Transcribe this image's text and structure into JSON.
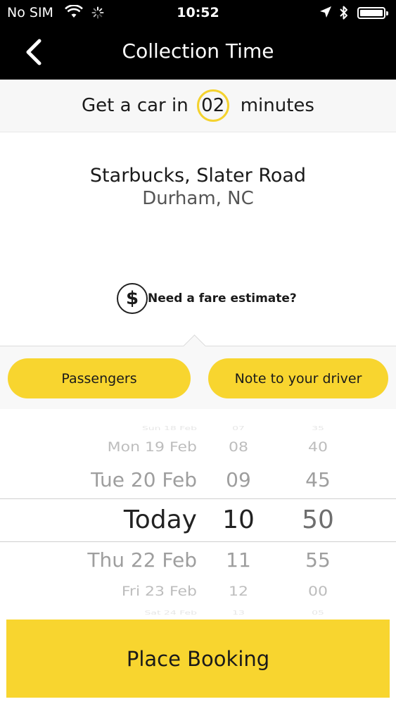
{
  "status": {
    "carrier": "No SIM",
    "time": "10:52"
  },
  "nav": {
    "title": "Collection Time",
    "back_icon": "chevron-left-icon"
  },
  "eta": {
    "prefix": "Get a car in",
    "minutes": "02",
    "suffix": "minutes"
  },
  "location": {
    "name": "Starbucks, Slater Road",
    "city": "Durham, NC"
  },
  "fare": {
    "icon": "$",
    "label": "Need a fare estimate?"
  },
  "options": {
    "passengers": "Passengers",
    "note": "Note to your driver"
  },
  "picker": {
    "days": [
      "Sun 18 Feb",
      "Mon 19 Feb",
      "Tue 20 Feb",
      "Today",
      "Thu 22 Feb",
      "Fri 23 Feb",
      "Sat 24 Feb"
    ],
    "hours": [
      "07",
      "08",
      "09",
      "10",
      "11",
      "12",
      "13"
    ],
    "minutes": [
      "35",
      "40",
      "45",
      "50",
      "55",
      "00",
      "05"
    ]
  },
  "actions": {
    "place_booking": "Place Booking"
  },
  "colors": {
    "accent": "#f8d52f",
    "bar": "#000000"
  }
}
